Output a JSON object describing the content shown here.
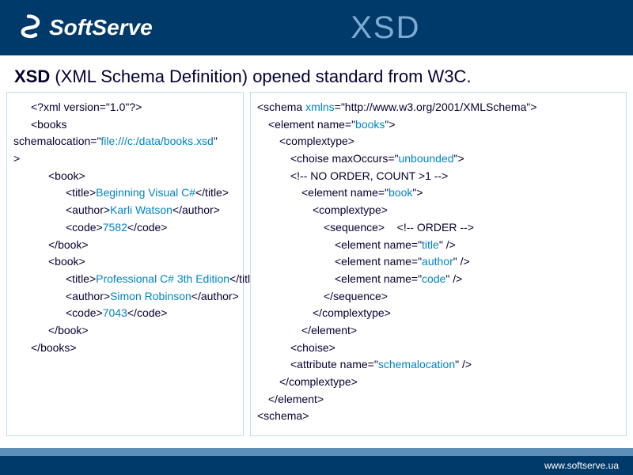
{
  "header": {
    "logo_text": "SoftServe",
    "title": "XSD"
  },
  "subhead": {
    "bold": "XSD",
    "rest": " (XML Schema Definition) opened standard from W3C."
  },
  "left": {
    "l1": "<?xml version=\"1.0\"?>",
    "l2a": "<books",
    "l3a": "schemalocation=\"",
    "l3b": "file:///c:/data/books.xsd",
    "l3c": "\"",
    "l4": ">",
    "b1_open": "<book>",
    "b1_title_o": "<title>",
    "b1_title_v": "Beginning Visual C#",
    "b1_title_c": "</title>",
    "b1_auth_o": "<author>",
    "b1_auth_v": "Karli Watson",
    "b1_auth_c": "</author>",
    "b1_code_o": "<code>",
    "b1_code_v": "7582",
    "b1_code_c": "</code>",
    "b1_close": "</book>",
    "b2_open": "<book>",
    "b2_title_o": "<title>",
    "b2_title_v": "Professional C# 3th Edition",
    "b2_title_c": "</title>",
    "b2_auth_o": "<author>",
    "b2_auth_v": "Simon Robinson",
    "b2_auth_c": "</author>",
    "b2_code_o": "<code>",
    "b2_code_v": "7043",
    "b2_code_c": "</code>",
    "b2_close": "</book>",
    "books_close": "</books>"
  },
  "right": {
    "l1a": "<schema ",
    "l1b": "xmlns",
    "l1c": "=\"http://www.w3.org/2001/XMLSchema\">",
    "l2a": "<element name=\"",
    "l2b": "books",
    "l2c": "\">",
    "l3": "<complextype>",
    "l4a": "<choise maxOccurs=\"",
    "l4b": "unbounded",
    "l4c": "\">",
    "l5": "<!-- NO ORDER, COUNT >1 -->",
    "l6a": "<element name=\"",
    "l6b": "book",
    "l6c": "\">",
    "l7": "<complextype>",
    "l8a": "<sequence>",
    "l8b": "<!-- ORDER -->",
    "l9a": "<element name=\"",
    "l9b": "title",
    "l9c": "\" />",
    "l10a": "<element name=\"",
    "l10b": "author",
    "l10c": "\" />",
    "l11a": "<element name=\"",
    "l11b": "code",
    "l11c": "\" />",
    "l12": "</sequence>",
    "l13": "</complextype>",
    "l14": "</element>",
    "l15": "<choise>",
    "l16a": "<attribute name=\"",
    "l16b": "schemalocation",
    "l16c": "\" />",
    "l17": "</complextype>",
    "l18": "</element>",
    "l19": "<schema>"
  },
  "footer": {
    "url": "www.softserve.ua"
  }
}
